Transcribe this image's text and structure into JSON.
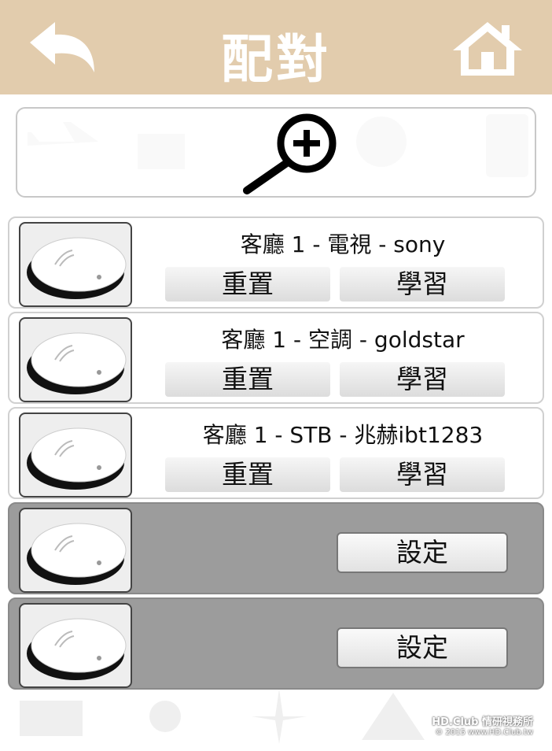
{
  "header": {
    "title": "配對",
    "back_icon": "back-arrow-icon",
    "home_icon": "home-icon"
  },
  "search": {
    "icon": "search-add-icon"
  },
  "devices": [
    {
      "name": "客廳 1 - 電視 - sony",
      "reset_label": "重置",
      "learn_label": "學習"
    },
    {
      "name": "客廳 1 - 空調 - goldstar",
      "reset_label": "重置",
      "learn_label": "學習"
    },
    {
      "name": "客廳 1 - STB - 兆赫ibt1283",
      "reset_label": "重置",
      "learn_label": "學習"
    }
  ],
  "empty_slots": [
    {
      "setting_label": "設定"
    },
    {
      "setting_label": "設定"
    }
  ],
  "watermark": {
    "line1": "HD.Club 情研視務所",
    "line2": "© 2015  www.HD.Club.tw"
  },
  "colors": {
    "header_bg": "#e2ccad",
    "inactive_row_bg": "#9c9c9c"
  }
}
